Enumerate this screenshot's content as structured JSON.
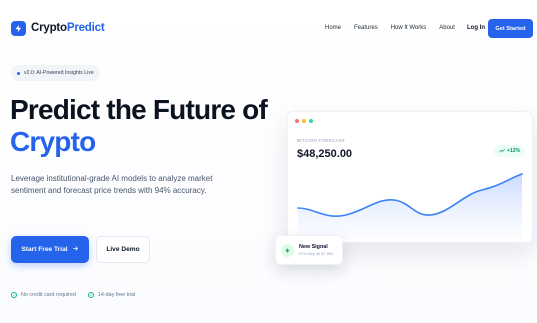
{
  "brand": {
    "name_part1": "Crypto",
    "name_part2": "Predict",
    "accent": "#2563eb"
  },
  "nav": {
    "links": [
      "Home",
      "Features",
      "How It Works",
      "About"
    ],
    "login": "Log In",
    "cta": "Get Started"
  },
  "hero": {
    "badge": "v2.0: AI-Powered Insights Live",
    "title_line1": "Predict the Future of",
    "title_line2": "Crypto",
    "lead": "Leverage institutional-grade AI models to analyze market sentiment and forecast price trends with 94% accuracy.",
    "primary_button": "Start Free Trial",
    "secondary_button": "Live Demo",
    "perks": [
      "No credit card required",
      "14-day free trial"
    ]
  },
  "forecast_card": {
    "label": "BITCOIN FORECAST",
    "price": "$48,250.00",
    "change": "+12%",
    "colors": {
      "line": "#3b82f6",
      "fill_top": "#bfd3ff",
      "dot_red": "#f87171",
      "dot_yellow": "#fbbf24",
      "dot_green": "#34d399"
    }
  },
  "signal": {
    "title": "New Signal",
    "subtitle": "ETH Buy @ $7,800"
  },
  "icons": {
    "logo": "lightning-icon",
    "arrow": "arrow-right-icon",
    "check": "check-circle-icon",
    "trend": "trend-up-icon",
    "signal": "lightning-icon"
  }
}
